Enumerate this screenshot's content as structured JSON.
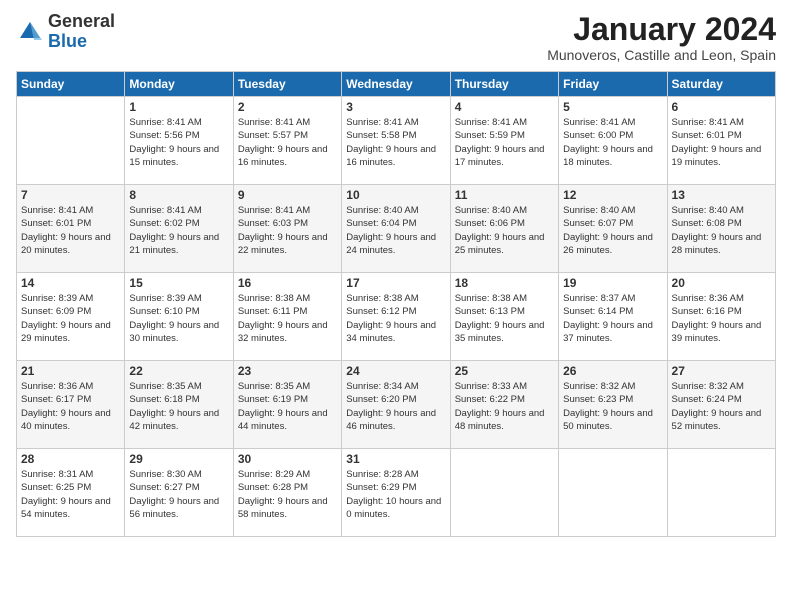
{
  "logo": {
    "general": "General",
    "blue": "Blue"
  },
  "title": {
    "month_year": "January 2024",
    "location": "Munoveros, Castille and Leon, Spain"
  },
  "header_days": [
    "Sunday",
    "Monday",
    "Tuesday",
    "Wednesday",
    "Thursday",
    "Friday",
    "Saturday"
  ],
  "weeks": [
    [
      {
        "day": "",
        "sunrise": "",
        "sunset": "",
        "daylight": ""
      },
      {
        "day": "1",
        "sunrise": "Sunrise: 8:41 AM",
        "sunset": "Sunset: 5:56 PM",
        "daylight": "Daylight: 9 hours and 15 minutes."
      },
      {
        "day": "2",
        "sunrise": "Sunrise: 8:41 AM",
        "sunset": "Sunset: 5:57 PM",
        "daylight": "Daylight: 9 hours and 16 minutes."
      },
      {
        "day": "3",
        "sunrise": "Sunrise: 8:41 AM",
        "sunset": "Sunset: 5:58 PM",
        "daylight": "Daylight: 9 hours and 16 minutes."
      },
      {
        "day": "4",
        "sunrise": "Sunrise: 8:41 AM",
        "sunset": "Sunset: 5:59 PM",
        "daylight": "Daylight: 9 hours and 17 minutes."
      },
      {
        "day": "5",
        "sunrise": "Sunrise: 8:41 AM",
        "sunset": "Sunset: 6:00 PM",
        "daylight": "Daylight: 9 hours and 18 minutes."
      },
      {
        "day": "6",
        "sunrise": "Sunrise: 8:41 AM",
        "sunset": "Sunset: 6:01 PM",
        "daylight": "Daylight: 9 hours and 19 minutes."
      }
    ],
    [
      {
        "day": "7",
        "sunrise": "Sunrise: 8:41 AM",
        "sunset": "Sunset: 6:01 PM",
        "daylight": "Daylight: 9 hours and 20 minutes."
      },
      {
        "day": "8",
        "sunrise": "Sunrise: 8:41 AM",
        "sunset": "Sunset: 6:02 PM",
        "daylight": "Daylight: 9 hours and 21 minutes."
      },
      {
        "day": "9",
        "sunrise": "Sunrise: 8:41 AM",
        "sunset": "Sunset: 6:03 PM",
        "daylight": "Daylight: 9 hours and 22 minutes."
      },
      {
        "day": "10",
        "sunrise": "Sunrise: 8:40 AM",
        "sunset": "Sunset: 6:04 PM",
        "daylight": "Daylight: 9 hours and 24 minutes."
      },
      {
        "day": "11",
        "sunrise": "Sunrise: 8:40 AM",
        "sunset": "Sunset: 6:06 PM",
        "daylight": "Daylight: 9 hours and 25 minutes."
      },
      {
        "day": "12",
        "sunrise": "Sunrise: 8:40 AM",
        "sunset": "Sunset: 6:07 PM",
        "daylight": "Daylight: 9 hours and 26 minutes."
      },
      {
        "day": "13",
        "sunrise": "Sunrise: 8:40 AM",
        "sunset": "Sunset: 6:08 PM",
        "daylight": "Daylight: 9 hours and 28 minutes."
      }
    ],
    [
      {
        "day": "14",
        "sunrise": "Sunrise: 8:39 AM",
        "sunset": "Sunset: 6:09 PM",
        "daylight": "Daylight: 9 hours and 29 minutes."
      },
      {
        "day": "15",
        "sunrise": "Sunrise: 8:39 AM",
        "sunset": "Sunset: 6:10 PM",
        "daylight": "Daylight: 9 hours and 30 minutes."
      },
      {
        "day": "16",
        "sunrise": "Sunrise: 8:38 AM",
        "sunset": "Sunset: 6:11 PM",
        "daylight": "Daylight: 9 hours and 32 minutes."
      },
      {
        "day": "17",
        "sunrise": "Sunrise: 8:38 AM",
        "sunset": "Sunset: 6:12 PM",
        "daylight": "Daylight: 9 hours and 34 minutes."
      },
      {
        "day": "18",
        "sunrise": "Sunrise: 8:38 AM",
        "sunset": "Sunset: 6:13 PM",
        "daylight": "Daylight: 9 hours and 35 minutes."
      },
      {
        "day": "19",
        "sunrise": "Sunrise: 8:37 AM",
        "sunset": "Sunset: 6:14 PM",
        "daylight": "Daylight: 9 hours and 37 minutes."
      },
      {
        "day": "20",
        "sunrise": "Sunrise: 8:36 AM",
        "sunset": "Sunset: 6:16 PM",
        "daylight": "Daylight: 9 hours and 39 minutes."
      }
    ],
    [
      {
        "day": "21",
        "sunrise": "Sunrise: 8:36 AM",
        "sunset": "Sunset: 6:17 PM",
        "daylight": "Daylight: 9 hours and 40 minutes."
      },
      {
        "day": "22",
        "sunrise": "Sunrise: 8:35 AM",
        "sunset": "Sunset: 6:18 PM",
        "daylight": "Daylight: 9 hours and 42 minutes."
      },
      {
        "day": "23",
        "sunrise": "Sunrise: 8:35 AM",
        "sunset": "Sunset: 6:19 PM",
        "daylight": "Daylight: 9 hours and 44 minutes."
      },
      {
        "day": "24",
        "sunrise": "Sunrise: 8:34 AM",
        "sunset": "Sunset: 6:20 PM",
        "daylight": "Daylight: 9 hours and 46 minutes."
      },
      {
        "day": "25",
        "sunrise": "Sunrise: 8:33 AM",
        "sunset": "Sunset: 6:22 PM",
        "daylight": "Daylight: 9 hours and 48 minutes."
      },
      {
        "day": "26",
        "sunrise": "Sunrise: 8:32 AM",
        "sunset": "Sunset: 6:23 PM",
        "daylight": "Daylight: 9 hours and 50 minutes."
      },
      {
        "day": "27",
        "sunrise": "Sunrise: 8:32 AM",
        "sunset": "Sunset: 6:24 PM",
        "daylight": "Daylight: 9 hours and 52 minutes."
      }
    ],
    [
      {
        "day": "28",
        "sunrise": "Sunrise: 8:31 AM",
        "sunset": "Sunset: 6:25 PM",
        "daylight": "Daylight: 9 hours and 54 minutes."
      },
      {
        "day": "29",
        "sunrise": "Sunrise: 8:30 AM",
        "sunset": "Sunset: 6:27 PM",
        "daylight": "Daylight: 9 hours and 56 minutes."
      },
      {
        "day": "30",
        "sunrise": "Sunrise: 8:29 AM",
        "sunset": "Sunset: 6:28 PM",
        "daylight": "Daylight: 9 hours and 58 minutes."
      },
      {
        "day": "31",
        "sunrise": "Sunrise: 8:28 AM",
        "sunset": "Sunset: 6:29 PM",
        "daylight": "Daylight: 10 hours and 0 minutes."
      },
      {
        "day": "",
        "sunrise": "",
        "sunset": "",
        "daylight": ""
      },
      {
        "day": "",
        "sunrise": "",
        "sunset": "",
        "daylight": ""
      },
      {
        "day": "",
        "sunrise": "",
        "sunset": "",
        "daylight": ""
      }
    ]
  ]
}
